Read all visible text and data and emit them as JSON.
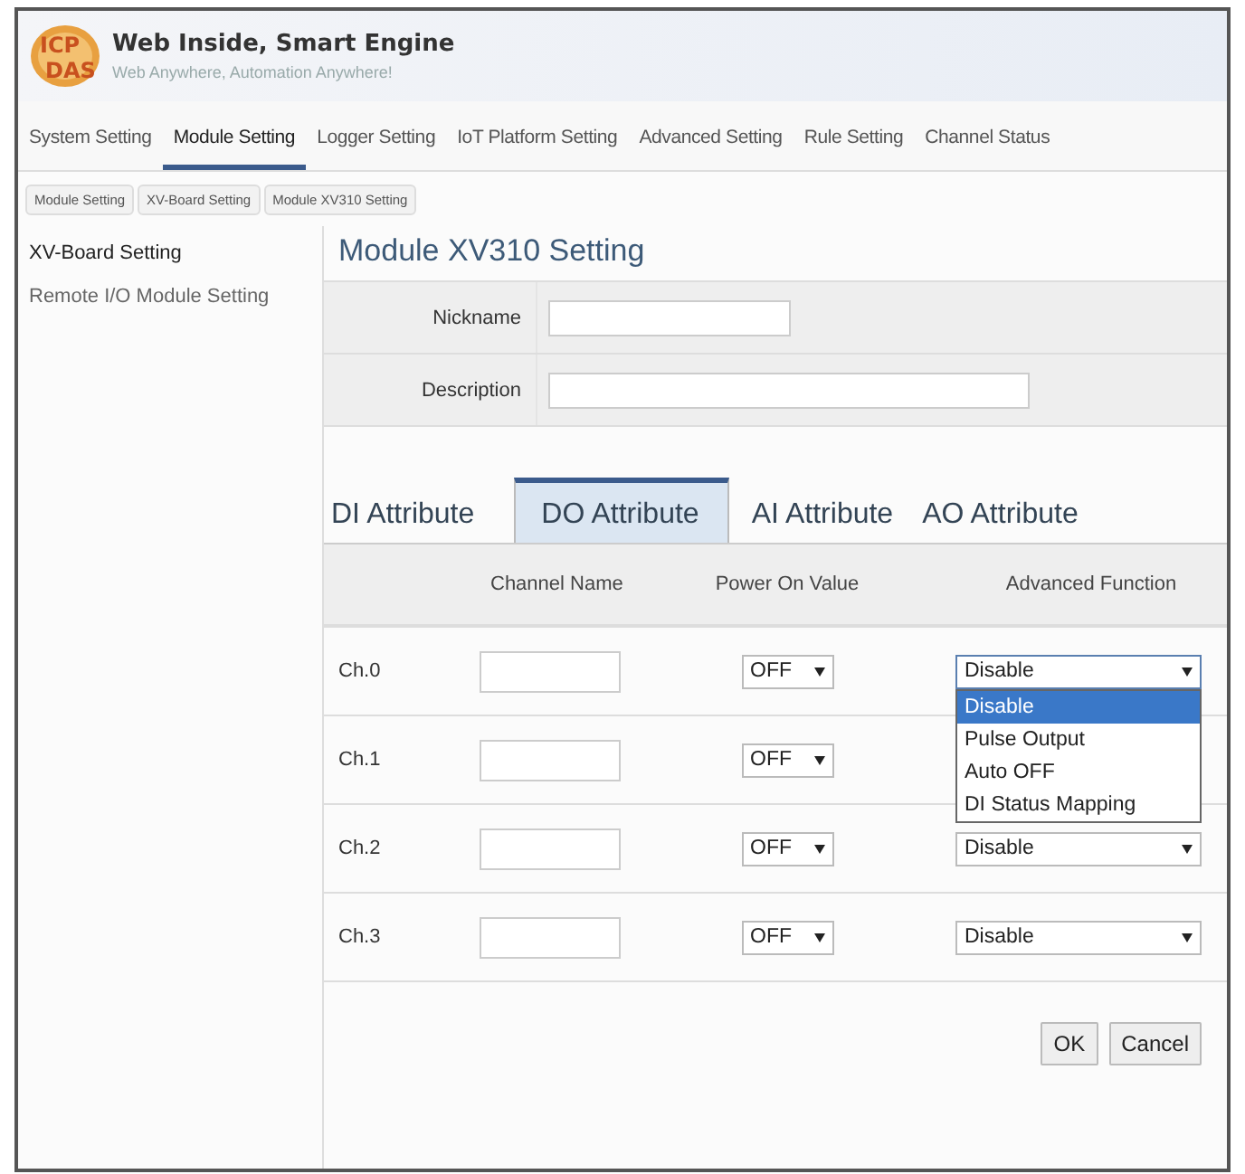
{
  "header": {
    "logo": [
      "ICP",
      "DAS"
    ],
    "title": "Web Inside, Smart Engine",
    "subtitle": "Web Anywhere, Automation Anywhere!"
  },
  "nav": [
    {
      "label": "System Setting",
      "selected": false
    },
    {
      "label": "Module Setting",
      "selected": true
    },
    {
      "label": "Logger Setting",
      "selected": false
    },
    {
      "label": "IoT Platform Setting",
      "selected": false
    },
    {
      "label": "Advanced Setting",
      "selected": false
    },
    {
      "label": "Rule Setting",
      "selected": false
    },
    {
      "label": "Channel Status",
      "selected": false
    }
  ],
  "breadcrumb": [
    "Module Setting",
    "XV-Board Setting",
    "Module XV310 Setting"
  ],
  "sidebar": {
    "items": [
      {
        "label": "XV-Board Setting",
        "selected": true
      },
      {
        "label": "Remote I/O Module Setting",
        "selected": false
      }
    ]
  },
  "page_title": "Module XV310 Setting",
  "form": [
    {
      "label": "Nickname"
    },
    {
      "label": "Description"
    }
  ],
  "tabs": [
    {
      "label": "DI Attribute",
      "selected": false
    },
    {
      "label": "DO Attribute",
      "selected": true
    },
    {
      "label": "AI Attribute",
      "selected": false
    },
    {
      "label": "AO Attribute",
      "selected": false
    }
  ],
  "table": {
    "columns": [
      "Channel Name",
      "Power On Value",
      "Advanced Function"
    ],
    "rows": [
      {
        "channel": "Ch.0",
        "power_on": "OFF",
        "advanced": "Disable",
        "expanded": true
      },
      {
        "channel": "Ch.1",
        "power_on": "OFF",
        "expanded": false
      },
      {
        "channel": "Ch.2",
        "power_on": "OFF",
        "advanced": "Disable",
        "expanded": false
      },
      {
        "channel": "Ch.3",
        "power_on": "OFF",
        "advanced": "Disable",
        "expanded": false
      }
    ]
  },
  "dropdown_options": [
    {
      "label": "Disable",
      "selected": true
    },
    {
      "label": "Pulse Output",
      "selected": false
    },
    {
      "label": "Auto OFF",
      "selected": false
    },
    {
      "label": "DI Status Mapping",
      "selected": false
    }
  ],
  "buttons": [
    "OK",
    "Cancel"
  ]
}
